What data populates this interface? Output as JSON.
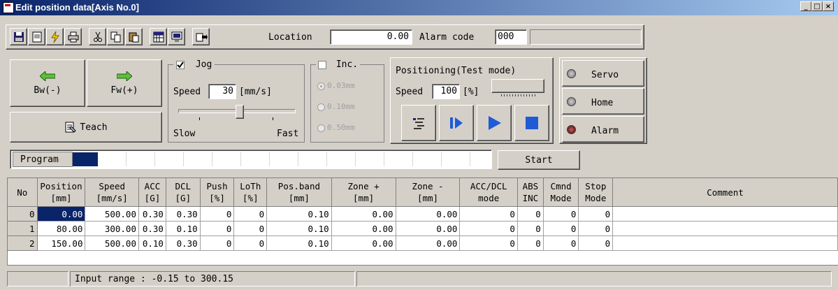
{
  "window": {
    "title": "Edit position data[Axis No.0]",
    "min": "_",
    "max": "□",
    "close": "×"
  },
  "toolbar": {
    "location_label": "Location",
    "location_value": "0.00",
    "alarm_label": "Alarm code",
    "alarm_value": "000",
    "icons": [
      "save-icon",
      "new-icon",
      "flash-icon",
      "print-icon",
      "cut-icon",
      "copy-icon",
      "paste-icon",
      "grid-icon",
      "monitor-icon",
      "export-icon"
    ]
  },
  "jog_buttons": {
    "bw": "Bw(-)",
    "fw": "Fw(+)",
    "teach": "Teach"
  },
  "jog": {
    "label": "Jog",
    "checked": true,
    "speed_label": "Speed",
    "speed_value": "30",
    "speed_unit": "[mm/s]",
    "slow": "Slow",
    "fast": "Fast"
  },
  "inc": {
    "label": "Inc.",
    "options": [
      "0.03mm",
      "0.10mm",
      "0.50mm"
    ]
  },
  "positioning": {
    "title": "Positioning(Test mode)",
    "speed_label": "Speed",
    "speed_value": "100",
    "speed_unit": "[%]"
  },
  "status": {
    "servo": "Servo",
    "home": "Home",
    "alarm": "Alarm"
  },
  "program": {
    "label": "Program",
    "start": "Start"
  },
  "table": {
    "headers": [
      [
        "No",
        ""
      ],
      [
        "Position",
        "[mm]"
      ],
      [
        "Speed",
        "[mm/s]"
      ],
      [
        "ACC",
        "[G]"
      ],
      [
        "DCL",
        "[G]"
      ],
      [
        "Push",
        "[%]"
      ],
      [
        "LoTh",
        "[%]"
      ],
      [
        "Pos.band",
        "[mm]"
      ],
      [
        "Zone +",
        "[mm]"
      ],
      [
        "Zone -",
        "[mm]"
      ],
      [
        "ACC/DCL",
        "mode"
      ],
      [
        "ABS",
        "INC"
      ],
      [
        "Cmnd",
        "Mode"
      ],
      [
        "Stop",
        "Mode"
      ],
      [
        "Comment",
        ""
      ]
    ],
    "rows": [
      [
        "0",
        "0.00",
        "500.00",
        "0.30",
        "0.30",
        "0",
        "0",
        "0.10",
        "0.00",
        "0.00",
        "0",
        "0",
        "0",
        "0",
        ""
      ],
      [
        "1",
        "80.00",
        "300.00",
        "0.30",
        "0.10",
        "0",
        "0",
        "0.10",
        "0.00",
        "0.00",
        "0",
        "0",
        "0",
        "0",
        ""
      ],
      [
        "2",
        "150.00",
        "500.00",
        "0.10",
        "0.30",
        "0",
        "0",
        "0.10",
        "0.00",
        "0.00",
        "0",
        "0",
        "0",
        "0",
        ""
      ]
    ]
  },
  "statusbar": {
    "text": "Input range : -0.15 to 300.15"
  },
  "colors": {
    "title_start": "#0a246a",
    "title_end": "#a6caf0",
    "face": "#d4d0c8",
    "play_blue": "#1f5bd6",
    "selection": "#0a246a"
  }
}
